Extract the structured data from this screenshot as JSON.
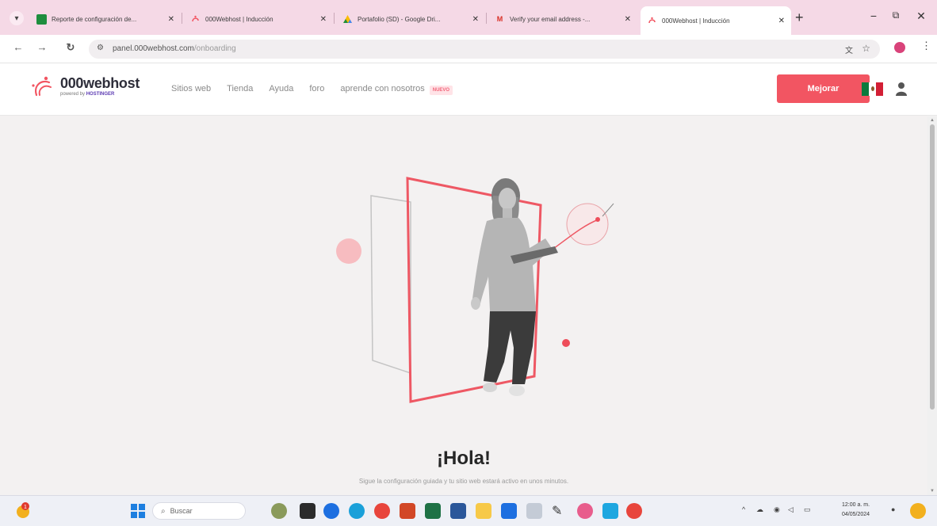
{
  "browser": {
    "tabs": [
      {
        "title": "Reporte de configuración de...",
        "favicon": "sheets-icon",
        "color": "#1e8e3e"
      },
      {
        "title": "000Webhost | Inducción",
        "favicon": "webhost-icon",
        "color": "#f25562"
      },
      {
        "title": "Portafolio (SD) - Google Dri...",
        "favicon": "drive-icon",
        "color": "#fbbc04"
      },
      {
        "title": "Verify your email address -...",
        "favicon": "gmail-icon",
        "color": "#d93025"
      },
      {
        "title": "000Webhost | Inducción",
        "favicon": "webhost-icon",
        "color": "#f25562"
      }
    ],
    "active_tab_index": 4,
    "url_host": "panel.000webhost.com",
    "url_path": "/onboarding"
  },
  "site": {
    "logo_name": "000webhost",
    "logo_powered": "powered by",
    "logo_partner": "HOSTINGER",
    "nav": [
      "Sitios web",
      "Tienda",
      "Ayuda",
      "foro",
      "aprende con nosotros"
    ],
    "nav_badge": "NUEVO",
    "upgrade_label": "Mejorar",
    "accent_color": "#f25562"
  },
  "main": {
    "greeting": "¡Hola!",
    "subtitle": "Sigue la configuración guiada y tu sitio web estará activo en unos minutos."
  },
  "taskbar": {
    "search_placeholder": "Buscar",
    "time": "12:00 a. m.",
    "date": "04/05/2024",
    "notification_count": "1"
  }
}
